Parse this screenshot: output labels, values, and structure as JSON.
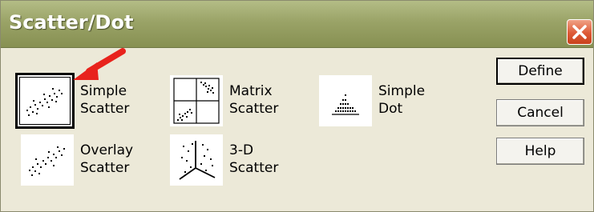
{
  "window": {
    "title": "Scatter/Dot",
    "close_icon": "close-icon"
  },
  "chart_types": [
    {
      "id": "simple-scatter",
      "line1": "Simple",
      "line2": "Scatter",
      "icon": "simple-scatter-icon",
      "selected": true
    },
    {
      "id": "matrix-scatter",
      "line1": "Matrix",
      "line2": "Scatter",
      "icon": "matrix-scatter-icon",
      "selected": false
    },
    {
      "id": "simple-dot",
      "line1": "Simple",
      "line2": "Dot",
      "icon": "simple-dot-icon",
      "selected": false
    },
    {
      "id": "overlay-scatter",
      "line1": "Overlay",
      "line2": "Scatter",
      "icon": "overlay-scatter-icon",
      "selected": false
    },
    {
      "id": "3d-scatter",
      "line1": "3-D",
      "line2": "Scatter",
      "icon": "3d-scatter-icon",
      "selected": false
    }
  ],
  "buttons": {
    "define": "Define",
    "cancel": "Cancel",
    "help": "Help"
  },
  "annotation": {
    "arrow_color": "#e8231c"
  }
}
